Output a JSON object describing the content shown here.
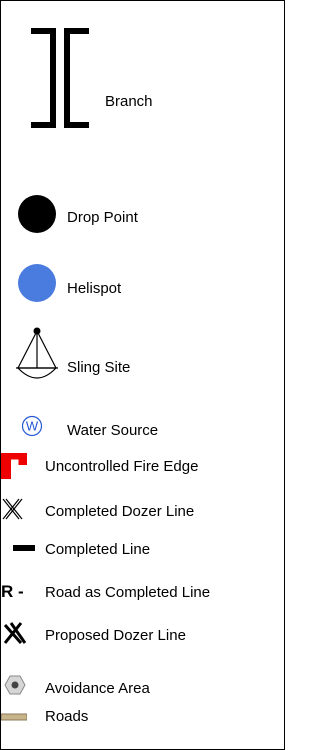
{
  "legend": {
    "items": [
      {
        "key": "branch",
        "label": "Branch"
      },
      {
        "key": "drop_point",
        "label": "Drop Point"
      },
      {
        "key": "helispot",
        "label": "Helispot"
      },
      {
        "key": "sling_site",
        "label": "Sling Site"
      },
      {
        "key": "water_source",
        "label": "Water Source",
        "symbol_text": "W"
      },
      {
        "key": "uncontrolled_fire_edge",
        "label": "Uncontrolled Fire Edge"
      },
      {
        "key": "completed_dozer_line",
        "label": "Completed Dozer Line"
      },
      {
        "key": "completed_line",
        "label": "Completed Line"
      },
      {
        "key": "road_as_completed_line",
        "label": "Road as Completed Line",
        "symbol_text": "R -"
      },
      {
        "key": "proposed_dozer_line",
        "label": "Proposed Dozer Line"
      },
      {
        "key": "avoidance_area",
        "label": "Avoidance Area"
      },
      {
        "key": "roads",
        "label": "Roads"
      }
    ]
  },
  "colors": {
    "helispot": "#4a7bdf",
    "water_source": "#2457d6",
    "uncontrolled_fire_edge": "#ee0000",
    "roads": "#c8b48a",
    "avoidance_area": "#9a9a9a"
  }
}
